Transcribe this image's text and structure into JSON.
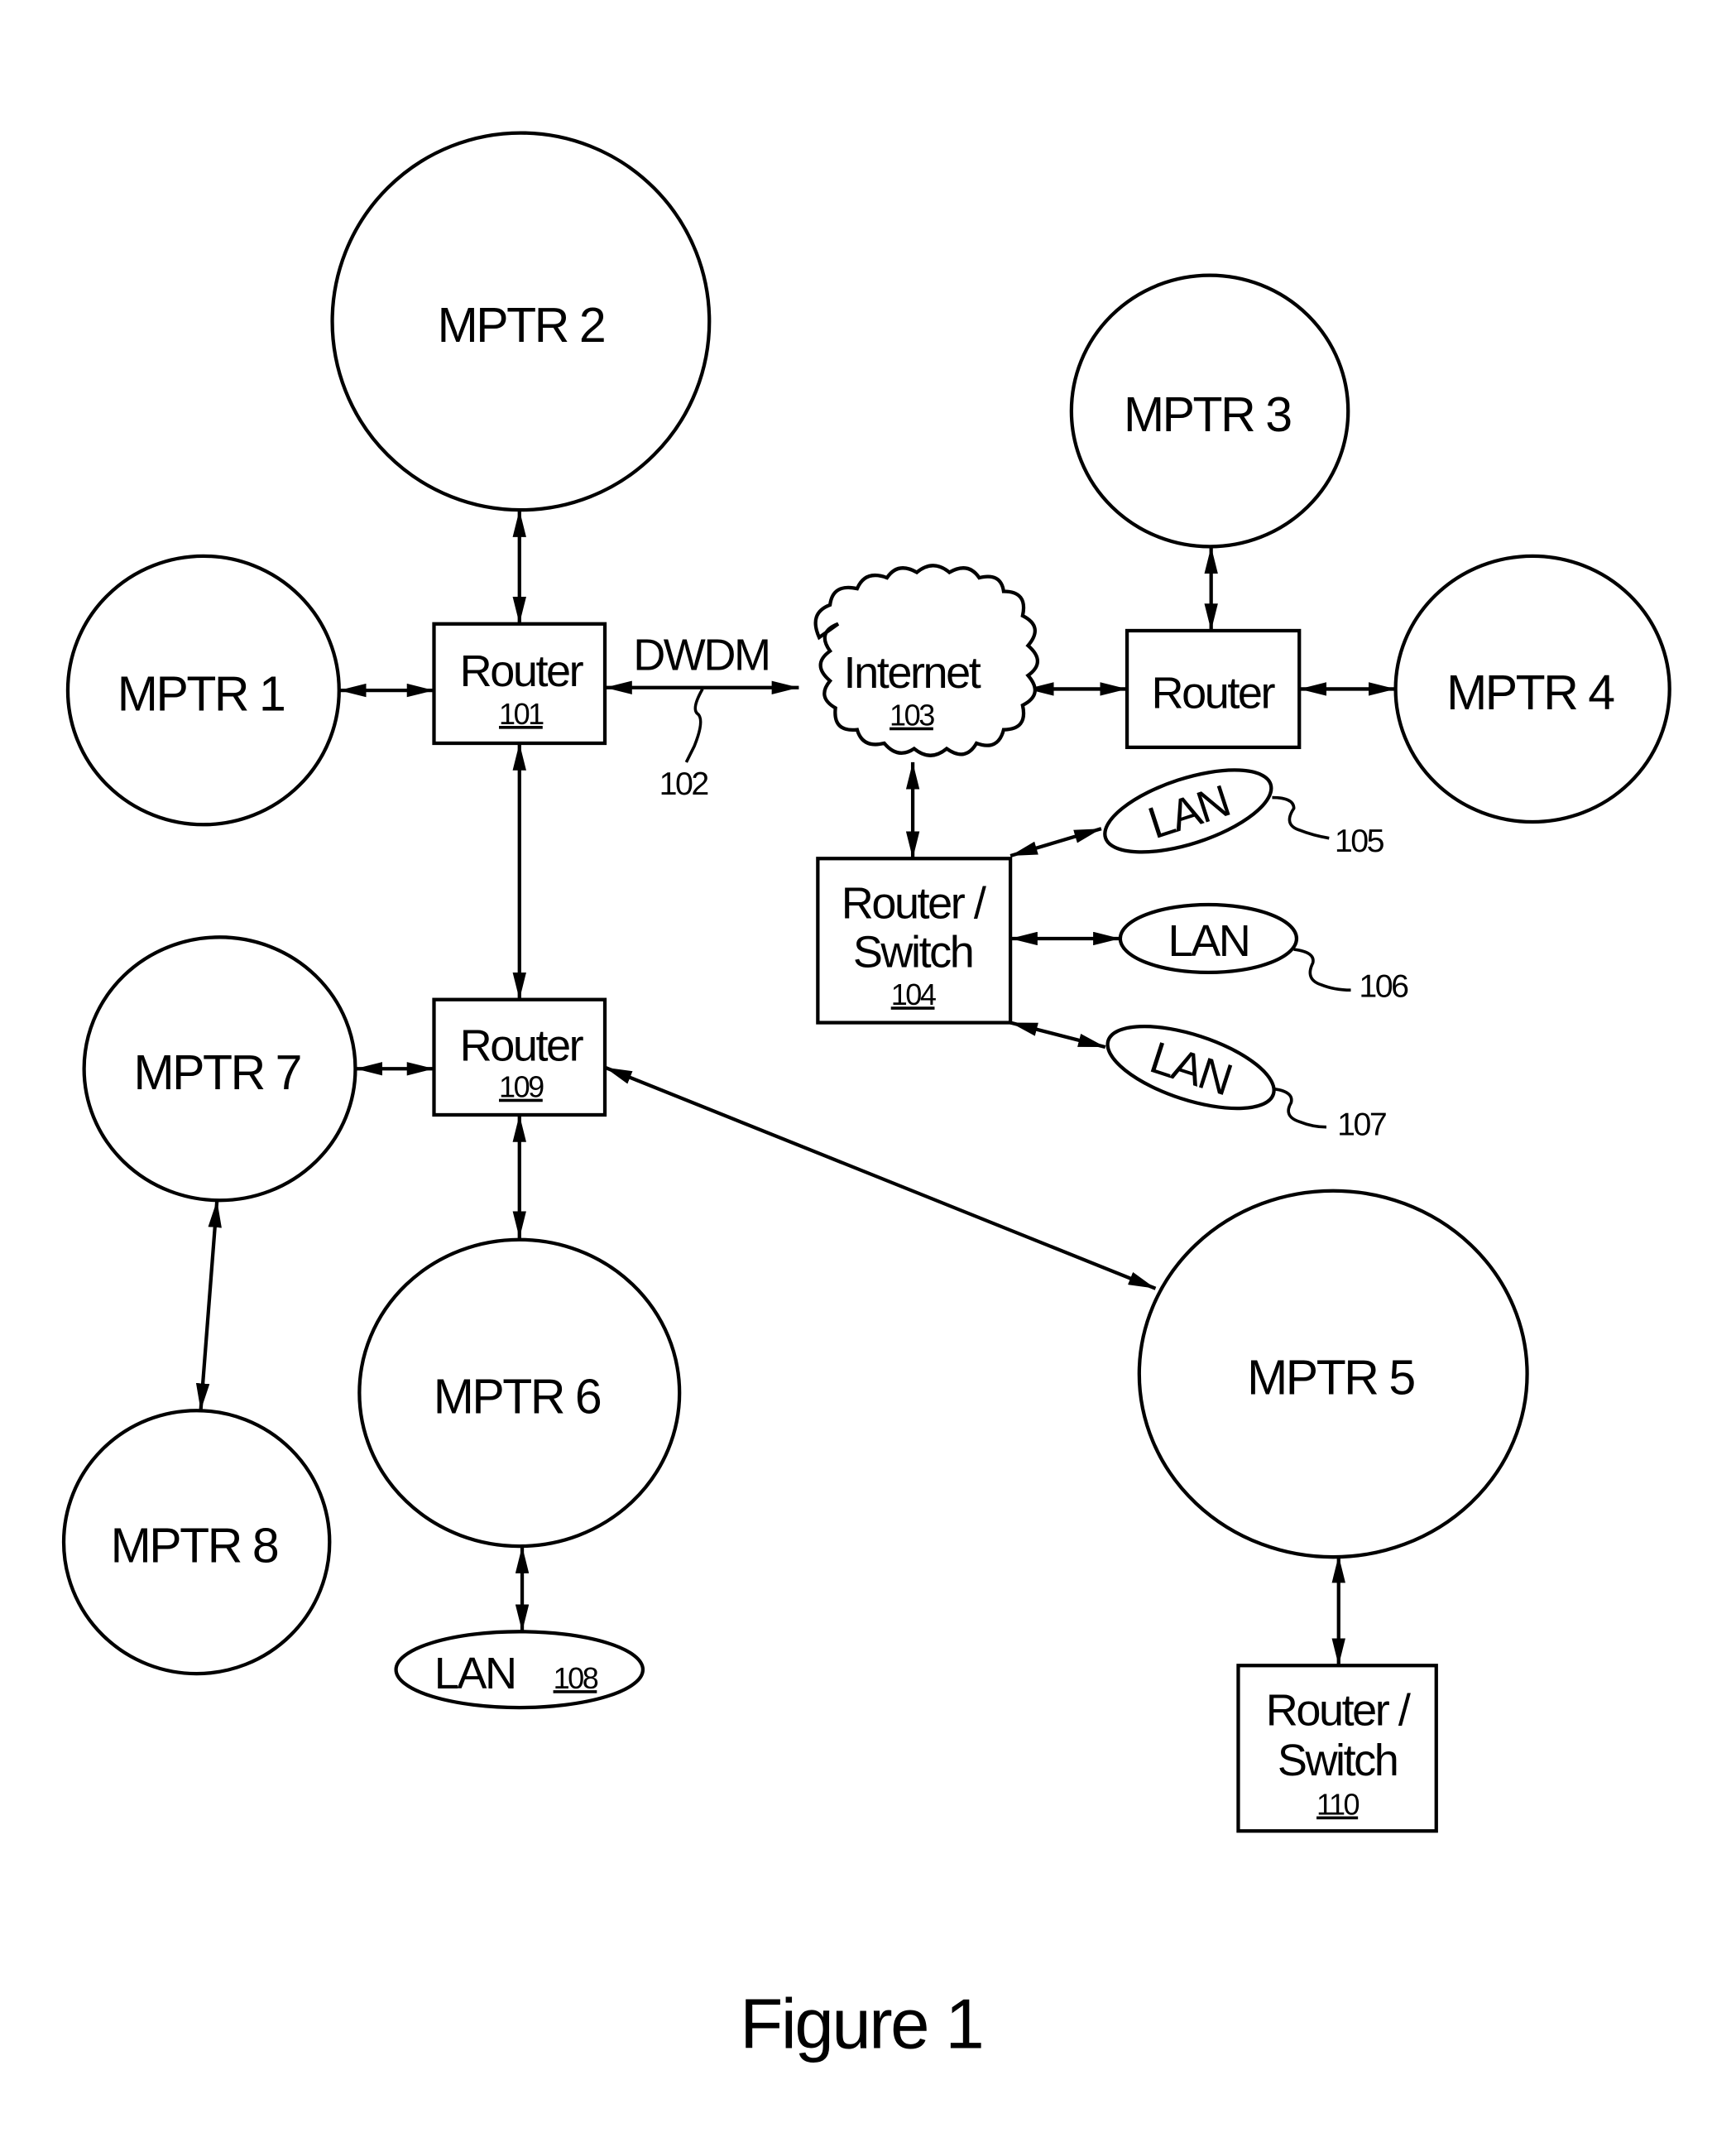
{
  "figure": {
    "caption": "Figure 1",
    "colors": {
      "ink": "#000000",
      "paper": "#ffffff"
    }
  },
  "nodes": {
    "mptr1": {
      "label": "MPTR 1"
    },
    "mptr2": {
      "label": "MPTR 2"
    },
    "mptr3": {
      "label": "MPTR 3"
    },
    "mptr4": {
      "label": "MPTR 4"
    },
    "mptr5": {
      "label": "MPTR 5"
    },
    "mptr6": {
      "label": "MPTR 6"
    },
    "mptr7": {
      "label": "MPTR 7"
    },
    "mptr8": {
      "label": "MPTR 8"
    },
    "router101": {
      "label": "Router",
      "ref": "101"
    },
    "router109": {
      "label": "Router",
      "ref": "109"
    },
    "router_right": {
      "label": "Router"
    },
    "internet": {
      "label": "Internet",
      "ref": "103"
    },
    "router_switch104": {
      "line1": "Router /",
      "line2": "Switch",
      "ref": "104"
    },
    "router_switch110": {
      "line1": "Router /",
      "line2": "Switch",
      "ref": "110"
    },
    "lan105": {
      "label": "LAN",
      "ref": "105"
    },
    "lan106": {
      "label": "LAN",
      "ref": "106"
    },
    "lan107": {
      "label": "LAN",
      "ref": "107"
    },
    "lan108": {
      "label": "LAN",
      "ref": "108"
    }
  },
  "links": {
    "dwdm": {
      "label": "DWDM",
      "ref": "102"
    }
  },
  "connections": [
    [
      "mptr1",
      "router101"
    ],
    [
      "mptr2",
      "router101"
    ],
    [
      "router101",
      "internet"
    ],
    [
      "router101",
      "router109"
    ],
    [
      "internet",
      "router_right"
    ],
    [
      "mptr3",
      "router_right"
    ],
    [
      "router_right",
      "mptr4"
    ],
    [
      "internet",
      "router_switch104"
    ],
    [
      "router_switch104",
      "lan105"
    ],
    [
      "router_switch104",
      "lan106"
    ],
    [
      "router_switch104",
      "lan107"
    ],
    [
      "mptr7",
      "router109"
    ],
    [
      "router109",
      "mptr6"
    ],
    [
      "router109",
      "mptr5"
    ],
    [
      "mptr7",
      "mptr8"
    ],
    [
      "mptr6",
      "lan108"
    ],
    [
      "mptr5",
      "router_switch110"
    ]
  ]
}
